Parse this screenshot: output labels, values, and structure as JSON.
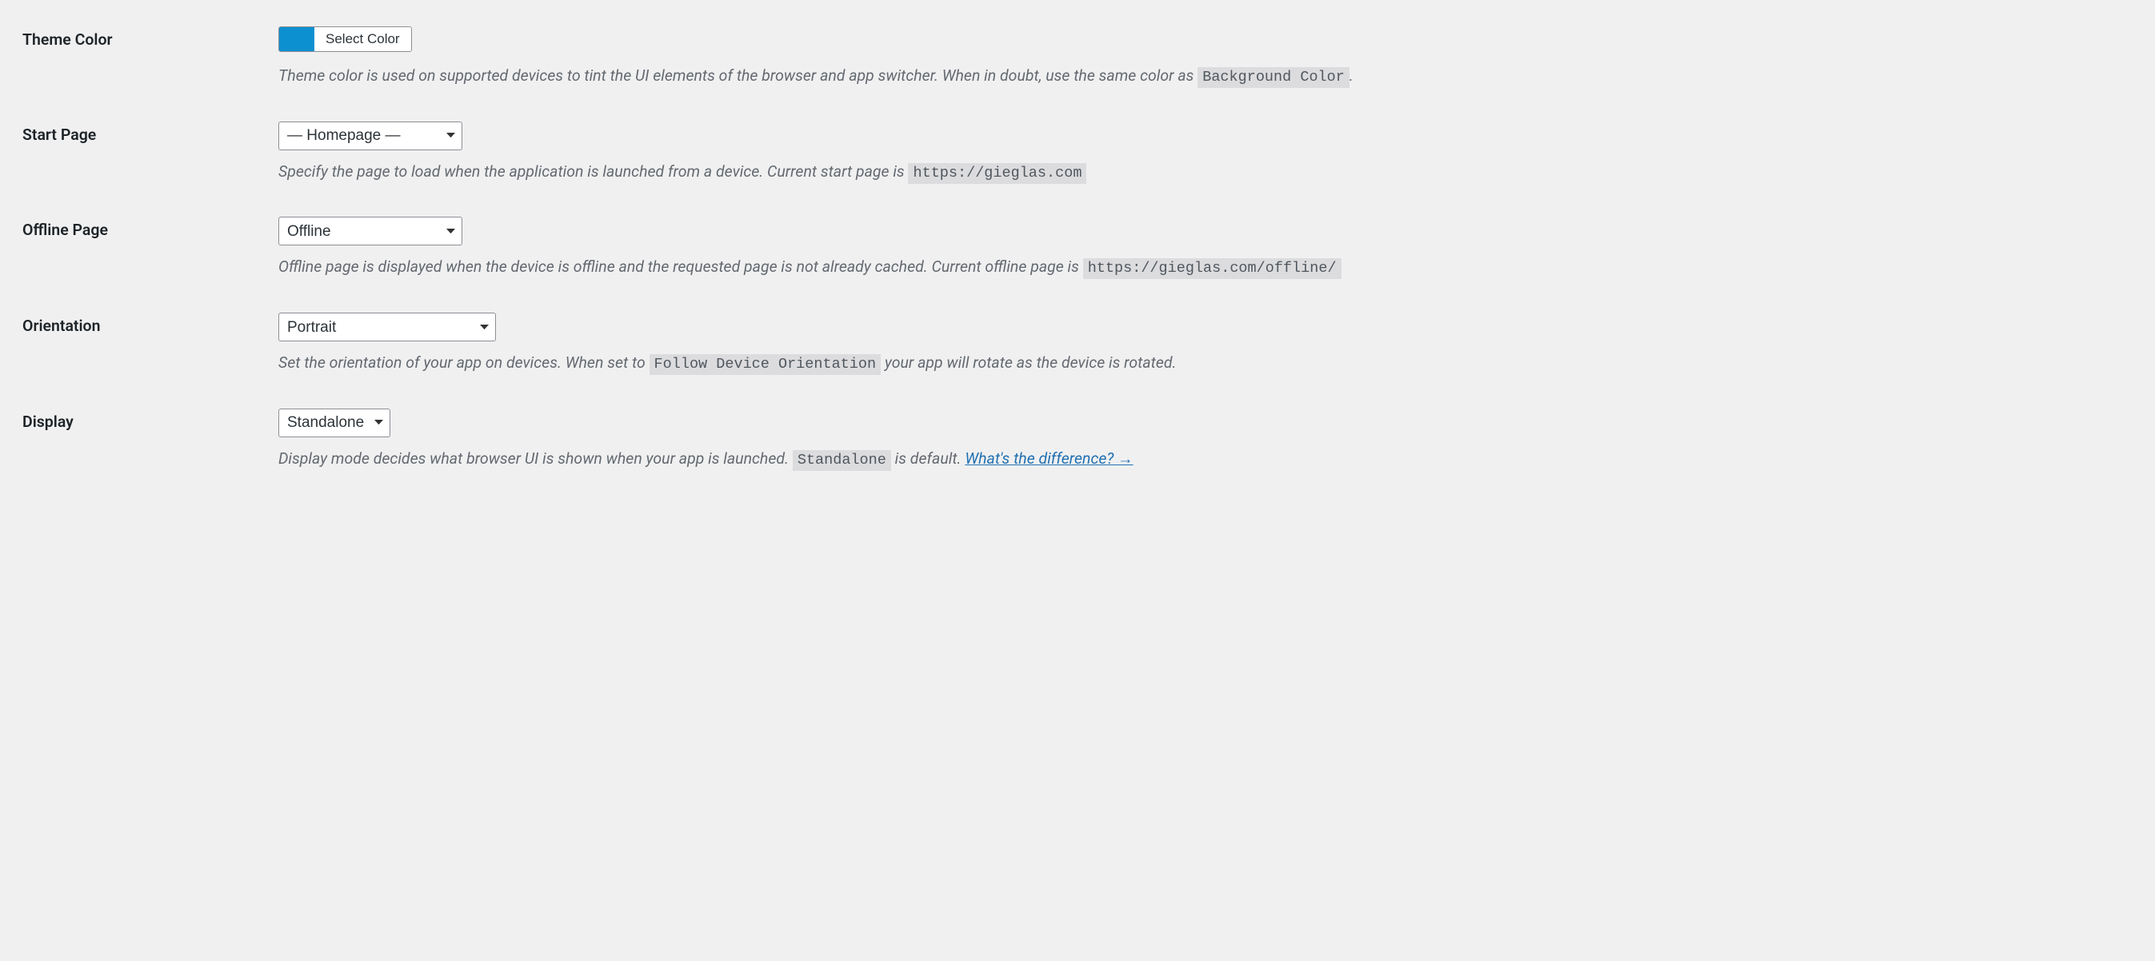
{
  "theme_color": {
    "label": "Theme Color",
    "button": "Select Color",
    "swatch_hex": "#0d90d0",
    "desc_before": "Theme color is used on supported devices to tint the UI elements of the browser and app switcher. When in doubt, use the same color as ",
    "desc_code": "Background Color",
    "desc_after": "."
  },
  "start_page": {
    "label": "Start Page",
    "selected": "— Homepage —",
    "desc_before": "Specify the page to load when the application is launched from a device. Current start page is ",
    "desc_code": "https://gieglas.com"
  },
  "offline_page": {
    "label": "Offline Page",
    "selected": "Offline",
    "desc_before": "Offline page is displayed when the device is offline and the requested page is not already cached. Current offline page is ",
    "desc_code": "https://gieglas.com/offline/"
  },
  "orientation": {
    "label": "Orientation",
    "selected": "Portrait",
    "desc_before": "Set the orientation of your app on devices. When set to ",
    "desc_code": "Follow Device Orientation",
    "desc_after": " your app will rotate as the device is rotated."
  },
  "display": {
    "label": "Display",
    "selected": "Standalone",
    "desc_before": "Display mode decides what browser UI is shown when your app is launched. ",
    "desc_code": "Standalone",
    "desc_mid": " is default. ",
    "link_text": "What's the difference? →"
  }
}
